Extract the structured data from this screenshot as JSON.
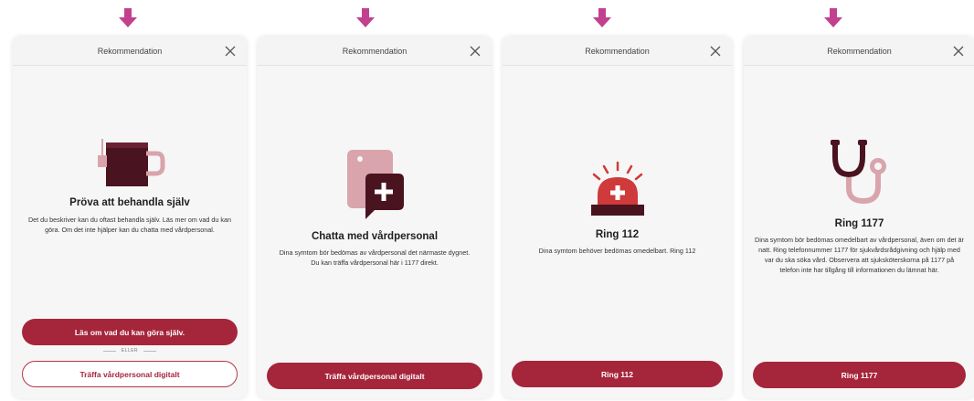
{
  "colors": {
    "arrow": "#c2418f",
    "primary": "#a5253b",
    "dark_maroon": "#4a1320",
    "pink": "#d9a4ac",
    "red": "#cf3a3a"
  },
  "cards": [
    {
      "header_title": "Rekommendation",
      "icon": "coffee-cup-icon",
      "heading": "Pröva att behandla själv",
      "description": "Det du beskriver kan du oftast behandla själv. Läs mer om vad du kan göra. Om det inte hjälper kan du chatta med vårdpersonal.",
      "primary_button": "Läs om vad du kan göra själv.",
      "separator": "ELLER",
      "secondary_button": "Träffa vårdpersonal digitalt"
    },
    {
      "header_title": "Rekommendation",
      "icon": "phone-chat-icon",
      "heading": "Chatta med vårdpersonal",
      "description": "Dina symtom bör bedömas av vårdpersonal det närmaste dygnet. Du kan träffa vårdpersonal här i 1177 direkt.",
      "primary_button": "Träffa vårdpersonal digitalt"
    },
    {
      "header_title": "Rekommendation",
      "icon": "emergency-siren-icon",
      "heading": "Ring 112",
      "description": "Dina symtom behöver bedömas omedelbart. Ring 112",
      "primary_button": "Ring 112"
    },
    {
      "header_title": "Rekommendation",
      "icon": "stethoscope-icon",
      "heading": "Ring 1177",
      "description": "Dina symtom bör bedömas omedelbart av vårdpersonal, även om det är natt. Ring telefonnummer 1177 för sjukvårdsrådgivning och hjälp med var du ska söka vård. Observera att sjuksköterskorna på 1177 på telefon inte har tillgång till informationen du lämnat här.",
      "primary_button": "Ring 1177"
    }
  ]
}
